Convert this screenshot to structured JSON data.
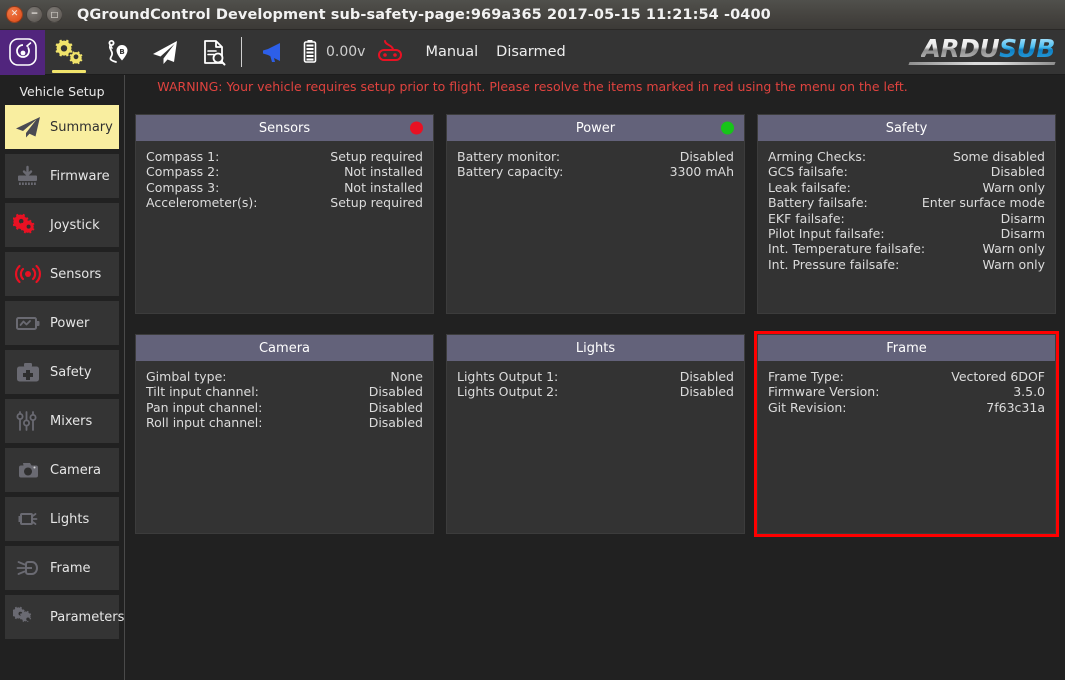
{
  "window": {
    "title": "QGroundControl Development sub-safety-page:969a365 2017-05-15 11:21:54 -0400",
    "close_glyph": "✕",
    "minimize_glyph": "−",
    "maximize_glyph": "□"
  },
  "toolbar": {
    "icons": [
      {
        "name": "qgc-app-icon",
        "label": ""
      },
      {
        "name": "gears-setup-icon",
        "label": ""
      },
      {
        "name": "plan-waypoints-icon",
        "label": ""
      },
      {
        "name": "fly-paper-plane-icon",
        "label": ""
      },
      {
        "name": "analyze-document-icon",
        "label": ""
      }
    ],
    "messages_icon": "megaphone-icon",
    "battery_icon": "battery-icon",
    "battery_value": "0.00v",
    "joystick_icon": "joystick-icon",
    "flight_mode": "Manual",
    "arm_state": "Disarmed",
    "logo_primary": "ARDU",
    "logo_secondary": "SUB"
  },
  "warning": {
    "text": "WARNING: Your vehicle requires setup prior to flight. Please resolve the items marked in red using the menu on the left.",
    "color": "#e0433f"
  },
  "sidebar": {
    "title": "Vehicle Setup",
    "items": [
      {
        "label": "Summary",
        "icon": "paper-plane-icon",
        "selected": true,
        "alert": false
      },
      {
        "label": "Firmware",
        "icon": "firmware-chip-icon",
        "selected": false,
        "alert": false
      },
      {
        "label": "Joystick",
        "icon": "joystick-gears-icon",
        "selected": false,
        "alert": true
      },
      {
        "label": "Sensors",
        "icon": "sensors-waves-icon",
        "selected": false,
        "alert": true
      },
      {
        "label": "Power",
        "icon": "battery-power-icon",
        "selected": false,
        "alert": false
      },
      {
        "label": "Safety",
        "icon": "safety-kit-icon",
        "selected": false,
        "alert": false
      },
      {
        "label": "Mixers",
        "icon": "mixers-sliders-icon",
        "selected": false,
        "alert": false
      },
      {
        "label": "Camera",
        "icon": "camera-icon",
        "selected": false,
        "alert": false
      },
      {
        "label": "Lights",
        "icon": "lights-icon",
        "selected": false,
        "alert": false
      },
      {
        "label": "Frame",
        "icon": "frame-thruster-icon",
        "selected": false,
        "alert": false
      },
      {
        "label": "Parameters",
        "icon": "parameters-gears-icon",
        "selected": false,
        "alert": false
      }
    ]
  },
  "panels": {
    "sensors": {
      "title": "Sensors",
      "status_color": "#e81123",
      "rows": [
        {
          "key": "Compass 1:",
          "value": "Setup required"
        },
        {
          "key": "Compass 2:",
          "value": "Not installed"
        },
        {
          "key": "Compass 3:",
          "value": "Not installed"
        },
        {
          "key": "Accelerometer(s):",
          "value": "Setup required"
        }
      ]
    },
    "power": {
      "title": "Power",
      "status_color": "#17c419",
      "rows": [
        {
          "key": "Battery monitor:",
          "value": "Disabled"
        },
        {
          "key": "Battery capacity:",
          "value": "3300 mAh"
        }
      ]
    },
    "safety": {
      "title": "Safety",
      "status_color": "",
      "rows": [
        {
          "key": "Arming Checks:",
          "value": "Some disabled"
        },
        {
          "key": "GCS failsafe:",
          "value": "Disabled"
        },
        {
          "key": "Leak failsafe:",
          "value": "Warn only"
        },
        {
          "key": "Battery failsafe:",
          "value": "Enter surface mode"
        },
        {
          "key": "EKF failsafe:",
          "value": "Disarm"
        },
        {
          "key": "Pilot Input failsafe:",
          "value": "Disarm"
        },
        {
          "key": "Int. Temperature failsafe:",
          "value": "Warn only"
        },
        {
          "key": "Int. Pressure failsafe:",
          "value": "Warn only"
        }
      ]
    },
    "camera": {
      "title": "Camera",
      "status_color": "",
      "rows": [
        {
          "key": "Gimbal type:",
          "value": "None"
        },
        {
          "key": "Tilt input channel:",
          "value": "Disabled"
        },
        {
          "key": "Pan input channel:",
          "value": "Disabled"
        },
        {
          "key": "Roll input channel:",
          "value": "Disabled"
        }
      ]
    },
    "lights": {
      "title": "Lights",
      "status_color": "",
      "rows": [
        {
          "key": "Lights Output 1:",
          "value": "Disabled"
        },
        {
          "key": "Lights Output 2:",
          "value": "Disabled"
        }
      ]
    },
    "frame": {
      "title": "Frame",
      "status_color": "",
      "highlight_color": "#ff0000",
      "rows": [
        {
          "key": "Frame Type:",
          "value": "Vectored 6DOF"
        },
        {
          "key": "Firmware Version:",
          "value": "3.5.0"
        },
        {
          "key": "Git Revision:",
          "value": "7f63c31a"
        }
      ]
    }
  }
}
